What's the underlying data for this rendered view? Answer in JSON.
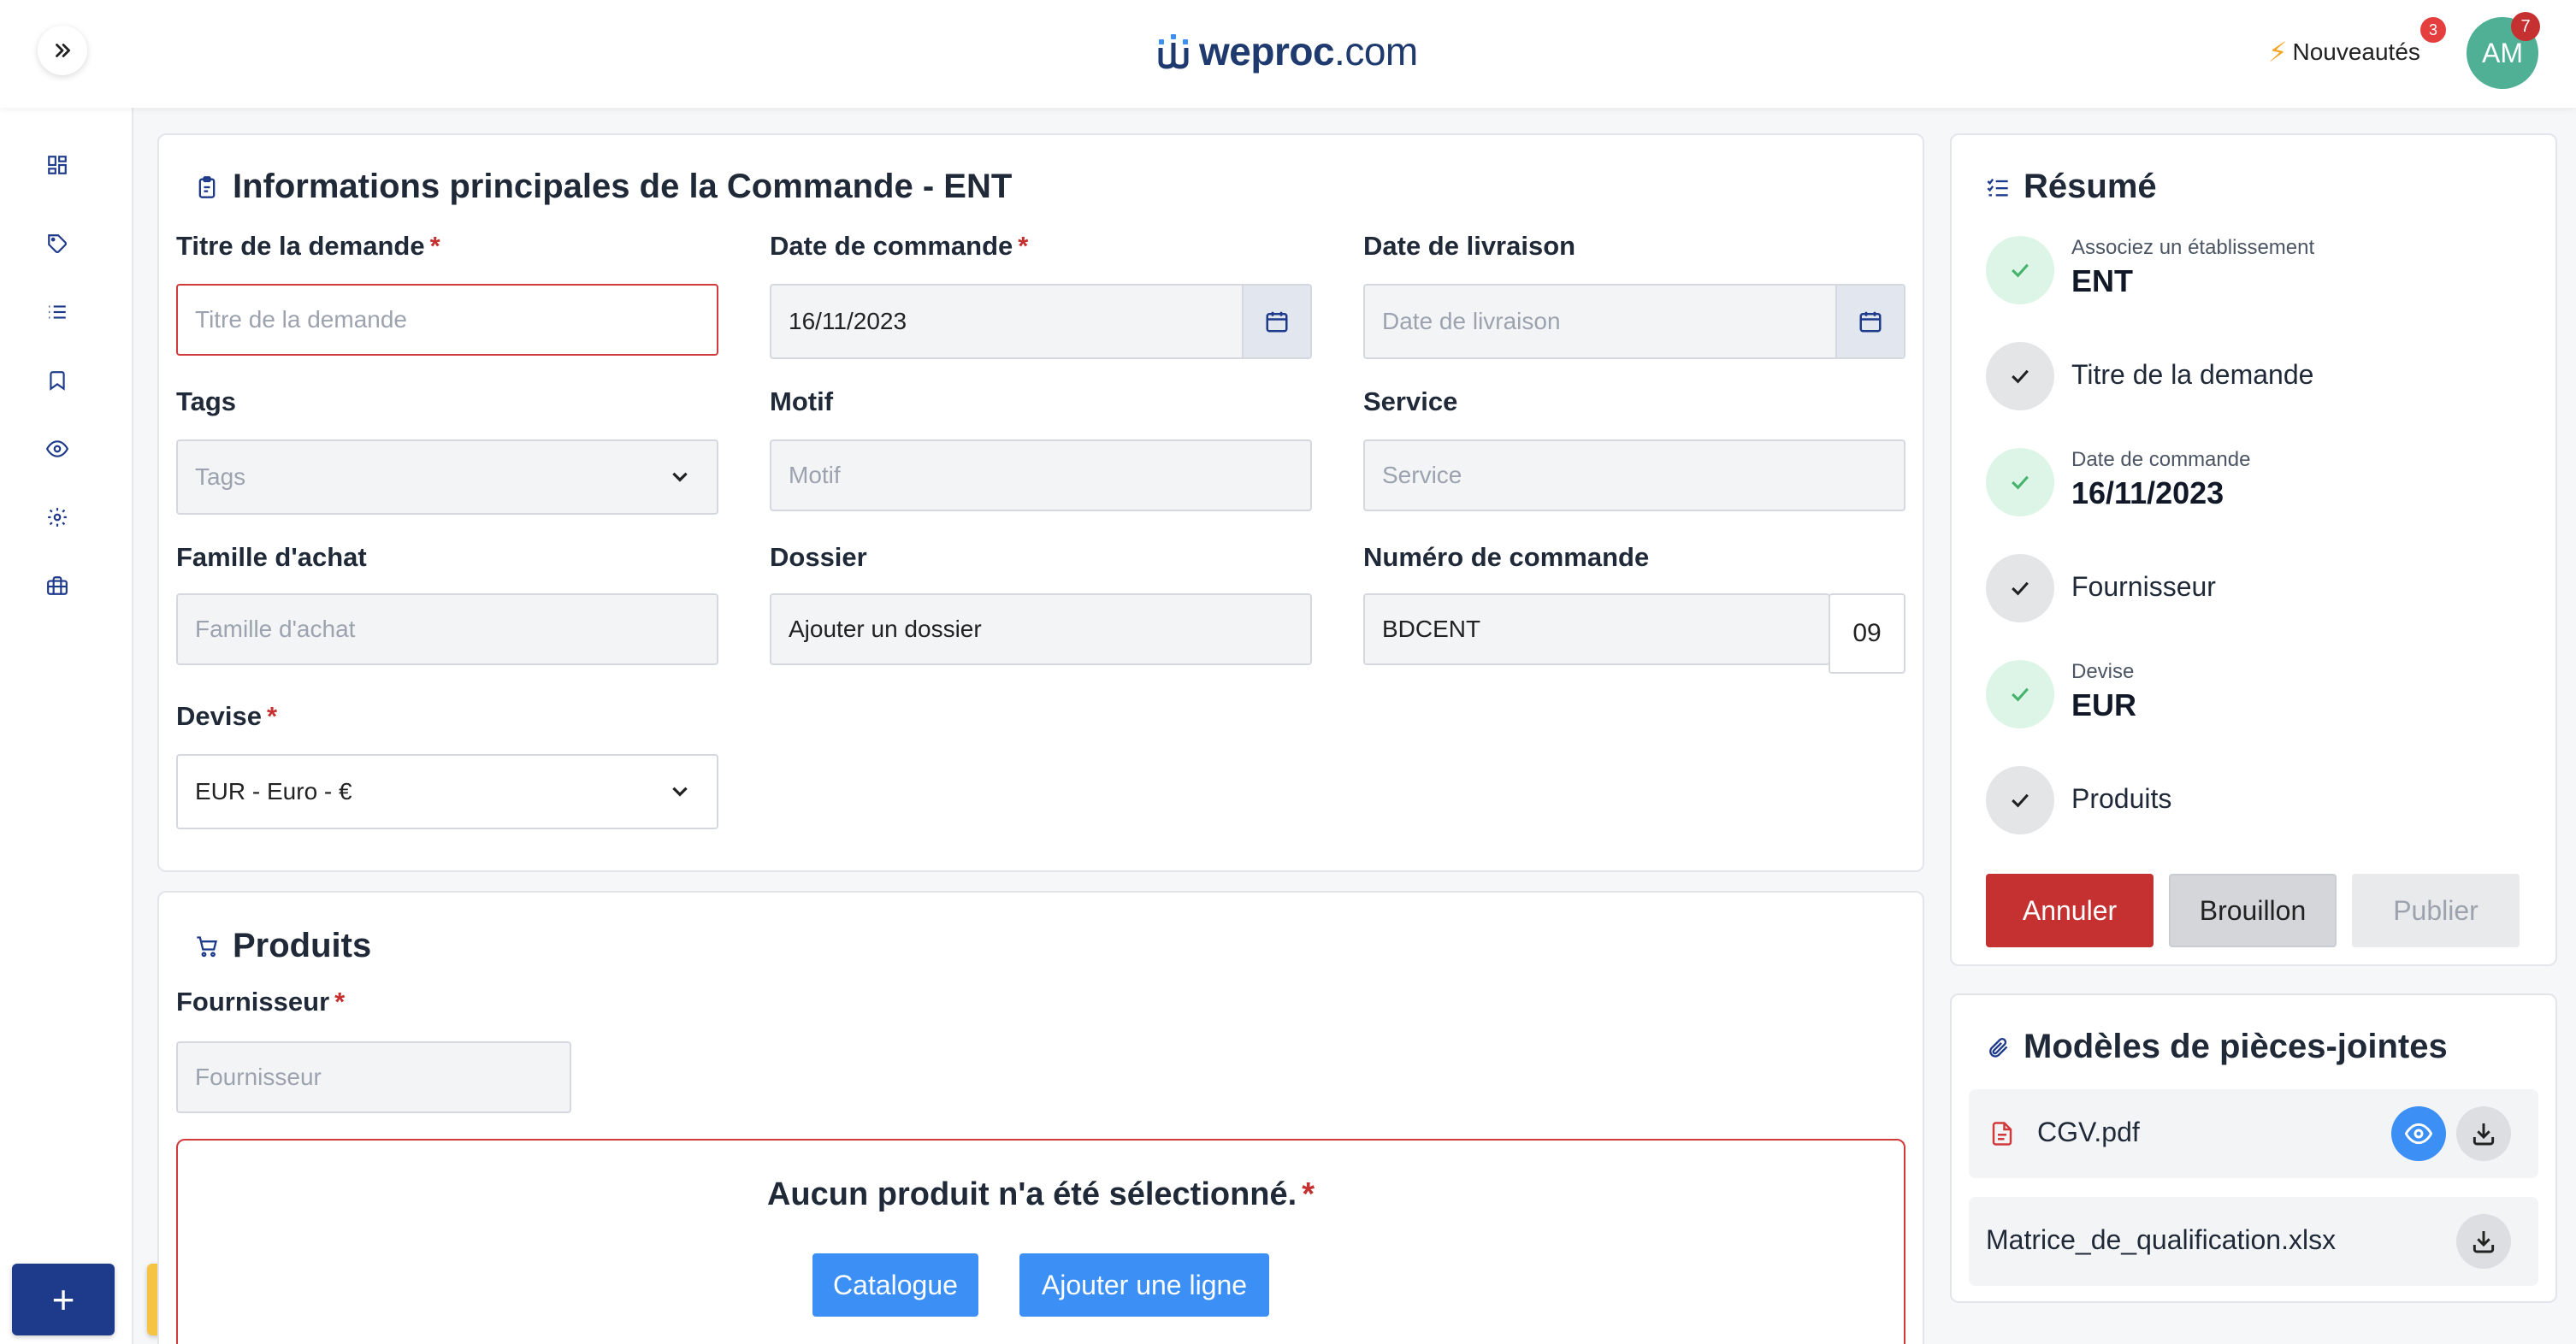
{
  "header": {
    "brand_bold": "weproc",
    "brand_domain": ".com",
    "news_label": "Nouveautés",
    "news_count": "3",
    "avatar_initials": "AM",
    "avatar_count": "7"
  },
  "sidebar": {
    "icons": [
      "dashboard-icon",
      "tag-icon",
      "list-icon",
      "bookmark-icon",
      "eye-icon",
      "gear-icon",
      "briefcase-icon"
    ],
    "add_label": "+"
  },
  "main_info": {
    "title": "Informations principales de la Commande - ENT",
    "fields": {
      "titre": {
        "label": "Titre de la demande",
        "required": "*",
        "placeholder": "Titre de la demande"
      },
      "date_commande": {
        "label": "Date de commande",
        "required": "*",
        "value": "16/11/2023"
      },
      "date_livraison": {
        "label": "Date de livraison",
        "placeholder": "Date de livraison"
      },
      "tags": {
        "label": "Tags",
        "placeholder": "Tags"
      },
      "motif": {
        "label": "Motif",
        "placeholder": "Motif"
      },
      "service": {
        "label": "Service",
        "placeholder": "Service"
      },
      "famille": {
        "label": "Famille d'achat",
        "placeholder": "Famille d'achat"
      },
      "dossier": {
        "label": "Dossier",
        "value": "Ajouter un dossier"
      },
      "numero": {
        "label": "Numéro de commande",
        "value": "BDCENT",
        "suffix": "09"
      },
      "devise": {
        "label": "Devise",
        "required": "*",
        "value": "EUR - Euro - €"
      }
    }
  },
  "products": {
    "title": "Produits",
    "fournisseur_label": "Fournisseur",
    "fournisseur_required": "*",
    "fournisseur_placeholder": "Fournisseur",
    "empty_message": "Aucun produit n'a été sélectionné.",
    "empty_required": "*",
    "catalogue_label": "Catalogue",
    "add_line_label": "Ajouter une ligne"
  },
  "summary": {
    "title": "Résumé",
    "steps": [
      {
        "small": "Associez un établissement",
        "big": "ENT",
        "status": "done"
      },
      {
        "text": "Titre de la demande",
        "status": "todo"
      },
      {
        "small": "Date de commande",
        "big": "16/11/2023",
        "status": "done"
      },
      {
        "text": "Fournisseur",
        "status": "todo"
      },
      {
        "small": "Devise",
        "big": "EUR",
        "status": "done"
      },
      {
        "text": "Produits",
        "status": "todo"
      }
    ],
    "cancel_label": "Annuler",
    "draft_label": "Brouillon",
    "publish_label": "Publier",
    "colors": {
      "cancel": "#c53030",
      "draft": "#d4d6da",
      "publish": "#e9eaec"
    }
  },
  "attachments": {
    "title": "Modèles de pièces-jointes",
    "files": [
      {
        "name": "CGV.pdf",
        "icon": "pdf-file-icon"
      },
      {
        "name": "Matrice_de_qualification.xlsx"
      }
    ]
  }
}
